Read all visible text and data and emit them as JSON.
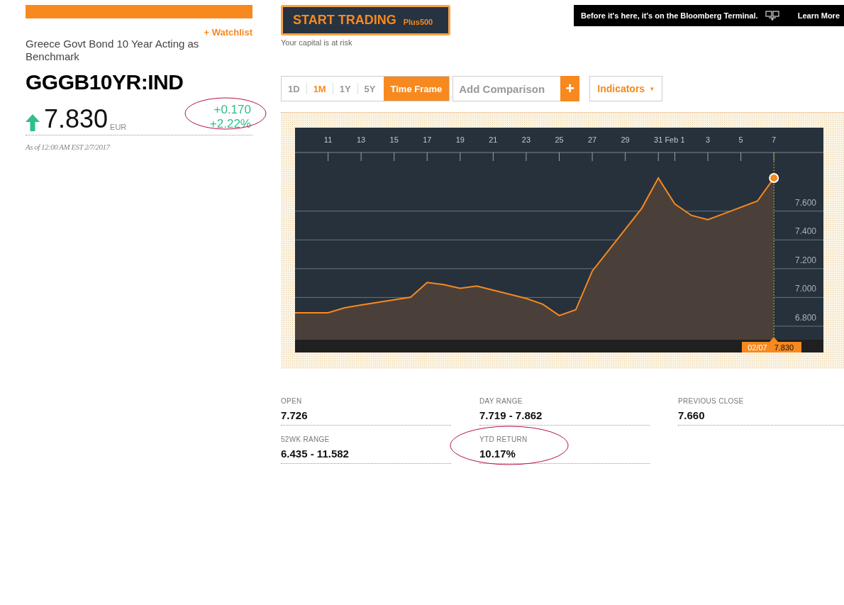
{
  "watchlist": "+ Watchlist",
  "name": "Greece Govt Bond 10 Year Acting as Benchmark",
  "ticker": "GGGB10YR:IND",
  "price": {
    "value": "7.830",
    "currency": "EUR",
    "rising": true,
    "change": "+0.170",
    "change_pct": "+2.22%",
    "circled": true
  },
  "as_of": "As of 12:00 AM EST 2/7/2017",
  "trading_button": {
    "label": "START TRADING",
    "brand": "Plus500"
  },
  "risk_note": "Your capital is at risk",
  "banner": {
    "text": "Before it's here, it's on the Bloomberg Terminal.",
    "link": "Learn More"
  },
  "ranges": [
    {
      "label": "1D",
      "selected": false
    },
    {
      "label": "1M",
      "selected": true
    },
    {
      "label": "1Y",
      "selected": false
    },
    {
      "label": "5Y",
      "selected": false
    }
  ],
  "time_frame": "Time Frame",
  "comparison": {
    "placeholder": "Add Comparison",
    "button": "+"
  },
  "indicators": {
    "label": "Indicators",
    "caret": "▼"
  },
  "chart": {
    "chart_data": {
      "type": "area",
      "grid": true,
      "x": [
        "2017-01-09",
        "2017-01-11",
        "2017-01-12",
        "2017-01-13",
        "2017-01-16",
        "2017-01-17",
        "2017-01-18",
        "2017-01-19",
        "2017-01-20",
        "2017-01-23",
        "2017-01-24",
        "2017-01-25",
        "2017-01-26",
        "2017-01-27",
        "2017-01-30",
        "2017-01-31",
        "2017-02-01",
        "2017-02-02",
        "2017-02-03",
        "2017-02-06",
        "2017-02-07"
      ],
      "series": [
        {
          "color": "#f7891f",
          "values": [
            6.894,
            6.894,
            6.928,
            6.948,
            7.002,
            7.104,
            7.089,
            7.064,
            7.079,
            6.993,
            6.953,
            6.874,
            6.914,
            7.183,
            7.62,
            7.83,
            7.65,
            7.57,
            7.54,
            7.67,
            7.83
          ]
        }
      ],
      "xlim": [
        "2017-01-09",
        "2017-02-10"
      ],
      "ylim": [
        6.706,
        8.18
      ],
      "ref_lines": [
        {
          "axis": "x",
          "value": "2017-02-07",
          "color": "#c9a24a"
        }
      ],
      "xticks": [
        {
          "value": "2017-01-11",
          "label": "11"
        },
        {
          "value": "2017-01-13",
          "label": "13"
        },
        {
          "value": "2017-01-15",
          "label": "15"
        },
        {
          "value": "2017-01-17",
          "label": "17"
        },
        {
          "value": "2017-01-19",
          "label": "19"
        },
        {
          "value": "2017-01-21",
          "label": "21"
        },
        {
          "value": "2017-01-23",
          "label": "23"
        },
        {
          "value": "2017-01-25",
          "label": "25"
        },
        {
          "value": "2017-01-27",
          "label": "27"
        },
        {
          "value": "2017-01-29",
          "label": "29"
        },
        {
          "value": "2017-01-31",
          "label": "31"
        },
        {
          "value": "2017-02-01",
          "label": "Feb 1"
        },
        {
          "value": "2017-02-03",
          "label": "3"
        },
        {
          "value": "2017-02-05",
          "label": "5"
        },
        {
          "value": "2017-02-07",
          "label": "7"
        }
      ],
      "yticks": [
        {
          "value": 6.8,
          "label": "6.800"
        },
        {
          "value": 7.0,
          "label": "7.000"
        },
        {
          "value": 7.2,
          "label": "7.200"
        },
        {
          "value": 7.4,
          "label": "7.400"
        },
        {
          "value": 7.6,
          "label": "7.600"
        }
      ]
    },
    "tooltip": {
      "date": "02/07",
      "value": "7.830"
    }
  },
  "stats": [
    {
      "label": "OPEN",
      "value": "7.726",
      "circled": false
    },
    {
      "label": "DAY RANGE",
      "value": "7.719 - 7.862",
      "circled": false
    },
    {
      "label": "PREVIOUS CLOSE",
      "value": "7.660",
      "circled": false
    },
    {
      "label": "52WK RANGE",
      "value": "6.435 - 11.582",
      "circled": false
    },
    {
      "label": "YTD RETURN",
      "value": "10.17%",
      "circled": true
    }
  ]
}
